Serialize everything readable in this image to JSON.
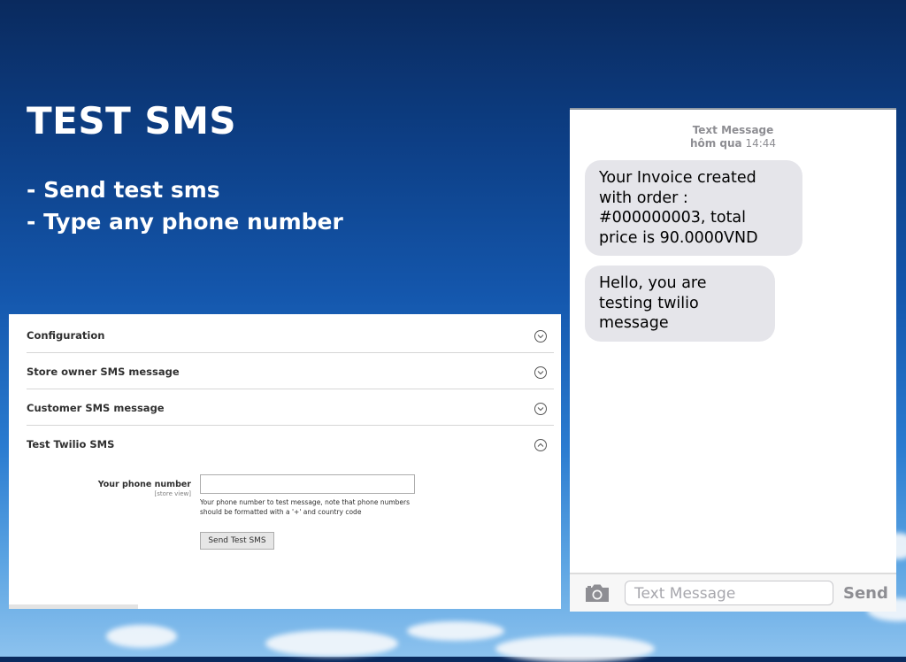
{
  "hero": {
    "title": "TEST SMS",
    "bullets": [
      "- Send test sms",
      "- Type any phone number"
    ]
  },
  "admin": {
    "sections": [
      {
        "title": "Configuration",
        "state": "collapsed"
      },
      {
        "title": "Store owner SMS message",
        "state": "collapsed"
      },
      {
        "title": "Customer SMS message",
        "state": "collapsed"
      },
      {
        "title": "Test Twilio SMS",
        "state": "expanded"
      }
    ],
    "phone_field": {
      "label": "Your phone number",
      "scope": "[store view]",
      "value": "",
      "note": "Your phone number to test message, note that phone numbers should be formatted with a '+' and country code"
    },
    "send_button": "Send Test SMS"
  },
  "phone": {
    "header_title": "Text Message",
    "header_day": "hôm qua",
    "header_time": "14:44",
    "messages": [
      "Your Invoice created with order : #000000003, total price is 90.0000VND",
      "Hello, you are testing twilio message"
    ],
    "compose_placeholder": "Text Message",
    "send_label": "Send"
  },
  "colors": {
    "bubble": "#e5e5ea",
    "sky_top": "#0a2a5e",
    "sky_bottom": "#8cc2ee"
  }
}
